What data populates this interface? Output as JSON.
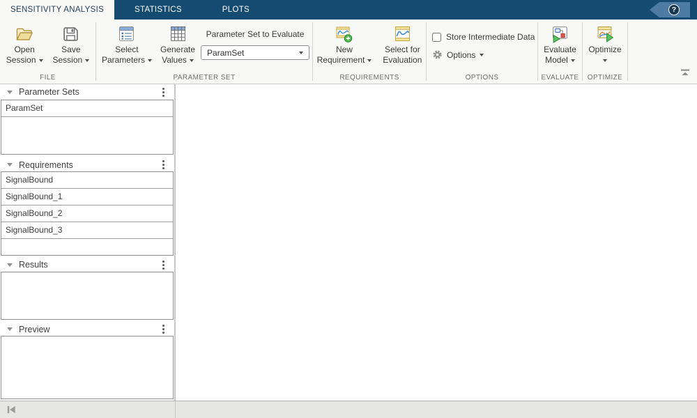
{
  "tab_bar": {
    "tabs": [
      {
        "label": "SENSITIVITY ANALYSIS",
        "active": true
      },
      {
        "label": "STATISTICS",
        "active": false
      },
      {
        "label": "PLOTS",
        "active": false
      }
    ],
    "help": {
      "glyph": "?"
    }
  },
  "toolbar": {
    "file": {
      "section_label": "FILE",
      "open_session": {
        "line1": "Open",
        "line2": "Session",
        "icon": "open-folder-icon",
        "has_dropdown": true
      },
      "save_session": {
        "line1": "Save",
        "line2": "Session",
        "icon": "save-floppy-icon",
        "has_dropdown": true
      }
    },
    "parameter_set": {
      "section_label": "PARAMETER SET",
      "select_parameters": {
        "line1": "Select",
        "line2": "Parameters",
        "icon": "parameter-list-icon",
        "has_dropdown": true
      },
      "generate_values": {
        "line1": "Generate",
        "line2": "Values",
        "icon": "value-grid-icon",
        "has_dropdown": true
      },
      "evaluate_combo": {
        "label": "Parameter Set to Evaluate",
        "value": "ParamSet"
      }
    },
    "requirements": {
      "section_label": "REQUIREMENTS",
      "new_requirement": {
        "line1": "New",
        "line2": "Requirement",
        "icon": "signal-plus-icon",
        "has_dropdown": true
      },
      "select_for_evaluation": {
        "line1": "Select for",
        "line2": "Evaluation",
        "icon": "signal-icon",
        "has_dropdown": false
      }
    },
    "options": {
      "section_label": "OPTIONS",
      "store_intermediate": {
        "label": "Store Intermediate Data",
        "checked": false
      },
      "options_menu": {
        "label": "Options",
        "icon": "gear-icon",
        "has_dropdown": true
      }
    },
    "evaluate": {
      "section_label": "EVALUATE",
      "evaluate_model": {
        "line1": "Evaluate",
        "line2": "Model",
        "icon": "evaluate-model-icon",
        "has_dropdown": true
      }
    },
    "optimize": {
      "section_label": "OPTIMIZE",
      "optimize": {
        "line1": "Optimize",
        "icon": "optimize-icon",
        "has_dropdown": true
      }
    }
  },
  "sidebar": {
    "panels": [
      {
        "title": "Parameter Sets",
        "items": [
          "ParamSet"
        ]
      },
      {
        "title": "Requirements",
        "items": [
          "SignalBound",
          "SignalBound_1",
          "SignalBound_2",
          "SignalBound_3"
        ]
      },
      {
        "title": "Results",
        "items": []
      },
      {
        "title": "Preview",
        "items": []
      }
    ]
  },
  "colors": {
    "tab_bar_background": "#154a71",
    "toolbar_background": "#f8f8f6",
    "accent_blue_icon": "#85aede",
    "signal_band_yellow": "#f5e3a0",
    "run_green": "#5cc25e",
    "status_bar_background": "#e6e6e4"
  }
}
